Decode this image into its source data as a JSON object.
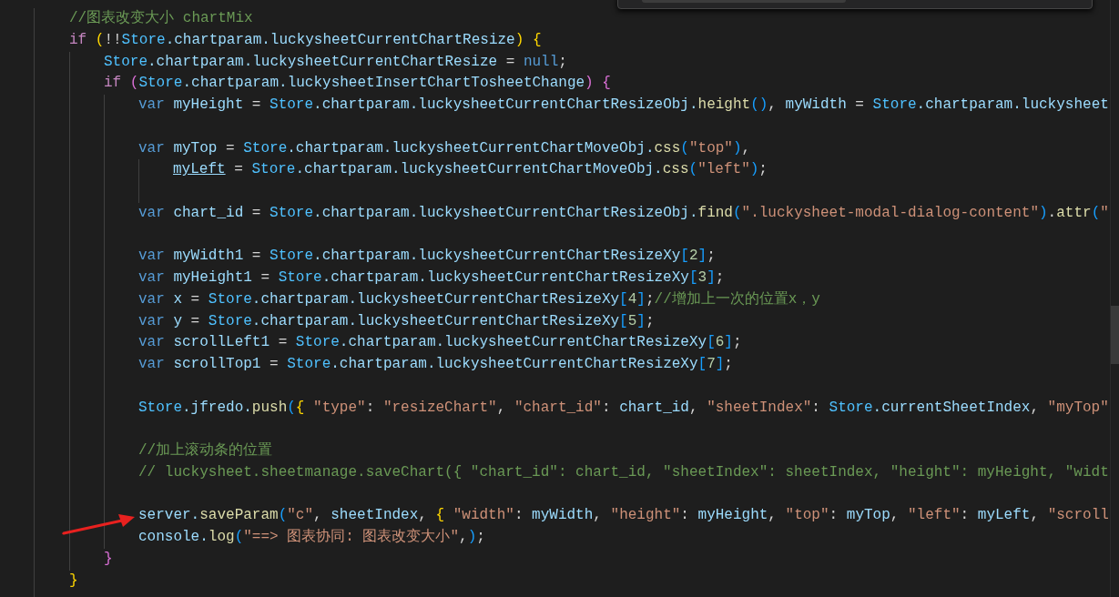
{
  "editor": {
    "lines": [
      {
        "kind": "code",
        "tokens": [
          {
            "kind": "cm",
            "text": "//图表改变大小 chartMix"
          }
        ]
      },
      {
        "kind": "code",
        "tokens": [
          {
            "kind": "kw",
            "text": "if"
          },
          {
            "kind": "b1",
            "text": " ("
          },
          {
            "kind": "p",
            "text": "!!"
          },
          {
            "kind": "obj",
            "text": "Store"
          },
          {
            "kind": "id",
            "text": ".chartparam.luckysheetCurrentChartResize"
          },
          {
            "kind": "b1",
            "text": ")"
          },
          {
            "kind": "b1",
            "text": " {"
          }
        ],
        "children": [
          {
            "kind": "code",
            "tokens": [
              {
                "kind": "obj",
                "text": "Store"
              },
              {
                "kind": "id",
                "text": ".chartparam.luckysheetCurrentChartResize"
              },
              {
                "kind": "p",
                "text": " = "
              },
              {
                "kind": "st",
                "text": "null"
              },
              {
                "kind": "p",
                "text": ";"
              }
            ]
          },
          {
            "kind": "code",
            "tokens": [
              {
                "kind": "kw",
                "text": "if"
              },
              {
                "kind": "b2",
                "text": " ("
              },
              {
                "kind": "obj",
                "text": "Store"
              },
              {
                "kind": "id",
                "text": ".chartparam.luckysheetInsertChartTosheetChange"
              },
              {
                "kind": "b2",
                "text": ")"
              },
              {
                "kind": "b2",
                "text": " {"
              }
            ],
            "children": [
              {
                "kind": "code",
                "tokens": [
                  {
                    "kind": "st",
                    "text": "var"
                  },
                  {
                    "kind": "id",
                    "text": " myHeight"
                  },
                  {
                    "kind": "p",
                    "text": " = "
                  },
                  {
                    "kind": "obj",
                    "text": "Store"
                  },
                  {
                    "kind": "id",
                    "text": ".chartparam.luckysheetCurrentChartResizeObj."
                  },
                  {
                    "kind": "fn",
                    "text": "height"
                  },
                  {
                    "kind": "b3",
                    "text": "()"
                  },
                  {
                    "kind": "p",
                    "text": ", "
                  },
                  {
                    "kind": "id",
                    "text": "myWidth"
                  },
                  {
                    "kind": "p",
                    "text": " = "
                  },
                  {
                    "kind": "obj",
                    "text": "Store"
                  },
                  {
                    "kind": "id",
                    "text": ".chartparam.luckysheet"
                  }
                ]
              },
              {
                "kind": "blank"
              },
              {
                "kind": "code",
                "tokens": [
                  {
                    "kind": "st",
                    "text": "var"
                  },
                  {
                    "kind": "id",
                    "text": " myTop"
                  },
                  {
                    "kind": "p",
                    "text": " = "
                  },
                  {
                    "kind": "obj",
                    "text": "Store"
                  },
                  {
                    "kind": "id",
                    "text": ".chartparam.luckysheetCurrentChartMoveObj."
                  },
                  {
                    "kind": "fn",
                    "text": "css"
                  },
                  {
                    "kind": "b3",
                    "text": "("
                  },
                  {
                    "kind": "str",
                    "text": "\"top\""
                  },
                  {
                    "kind": "b3",
                    "text": ")"
                  },
                  {
                    "kind": "p",
                    "text": ","
                  }
                ],
                "children": [
                  {
                    "kind": "code",
                    "tokens": [
                      {
                        "kind": "ul",
                        "text": "myLeft"
                      },
                      {
                        "kind": "p",
                        "text": " = "
                      },
                      {
                        "kind": "obj",
                        "text": "Store"
                      },
                      {
                        "kind": "id",
                        "text": ".chartparam.luckysheetCurrentChartMoveObj."
                      },
                      {
                        "kind": "fn",
                        "text": "css"
                      },
                      {
                        "kind": "b3",
                        "text": "("
                      },
                      {
                        "kind": "str",
                        "text": "\"left\""
                      },
                      {
                        "kind": "b3",
                        "text": ")"
                      },
                      {
                        "kind": "p",
                        "text": ";"
                      }
                    ]
                  },
                  {
                    "kind": "blank"
                  }
                ]
              },
              {
                "kind": "code",
                "tokens": [
                  {
                    "kind": "st",
                    "text": "var"
                  },
                  {
                    "kind": "id",
                    "text": " chart_id"
                  },
                  {
                    "kind": "p",
                    "text": " = "
                  },
                  {
                    "kind": "obj",
                    "text": "Store"
                  },
                  {
                    "kind": "id",
                    "text": ".chartparam.luckysheetCurrentChartResizeObj."
                  },
                  {
                    "kind": "fn",
                    "text": "find"
                  },
                  {
                    "kind": "b3",
                    "text": "("
                  },
                  {
                    "kind": "str",
                    "text": "\".luckysheet-modal-dialog-content\""
                  },
                  {
                    "kind": "b3",
                    "text": ")"
                  },
                  {
                    "kind": "p",
                    "text": "."
                  },
                  {
                    "kind": "fn",
                    "text": "attr"
                  },
                  {
                    "kind": "b3",
                    "text": "("
                  },
                  {
                    "kind": "str",
                    "text": "\""
                  }
                ]
              },
              {
                "kind": "blank"
              },
              {
                "kind": "code",
                "tokens": [
                  {
                    "kind": "st",
                    "text": "var"
                  },
                  {
                    "kind": "id",
                    "text": " myWidth1"
                  },
                  {
                    "kind": "p",
                    "text": " = "
                  },
                  {
                    "kind": "obj",
                    "text": "Store"
                  },
                  {
                    "kind": "id",
                    "text": ".chartparam.luckysheetCurrentChartResizeXy"
                  },
                  {
                    "kind": "b3",
                    "text": "["
                  },
                  {
                    "kind": "num",
                    "text": "2"
                  },
                  {
                    "kind": "b3",
                    "text": "]"
                  },
                  {
                    "kind": "p",
                    "text": ";"
                  }
                ]
              },
              {
                "kind": "code",
                "tokens": [
                  {
                    "kind": "st",
                    "text": "var"
                  },
                  {
                    "kind": "id",
                    "text": " myHeight1"
                  },
                  {
                    "kind": "p",
                    "text": " = "
                  },
                  {
                    "kind": "obj",
                    "text": "Store"
                  },
                  {
                    "kind": "id",
                    "text": ".chartparam.luckysheetCurrentChartResizeXy"
                  },
                  {
                    "kind": "b3",
                    "text": "["
                  },
                  {
                    "kind": "num",
                    "text": "3"
                  },
                  {
                    "kind": "b3",
                    "text": "]"
                  },
                  {
                    "kind": "p",
                    "text": ";"
                  }
                ]
              },
              {
                "kind": "code",
                "tokens": [
                  {
                    "kind": "st",
                    "text": "var"
                  },
                  {
                    "kind": "id",
                    "text": " x"
                  },
                  {
                    "kind": "p",
                    "text": " = "
                  },
                  {
                    "kind": "obj",
                    "text": "Store"
                  },
                  {
                    "kind": "id",
                    "text": ".chartparam.luckysheetCurrentChartResizeXy"
                  },
                  {
                    "kind": "b3",
                    "text": "["
                  },
                  {
                    "kind": "num",
                    "text": "4"
                  },
                  {
                    "kind": "b3",
                    "text": "]"
                  },
                  {
                    "kind": "p",
                    "text": ";"
                  },
                  {
                    "kind": "cm",
                    "text": "//增加上一次的位置x，y"
                  }
                ]
              },
              {
                "kind": "code",
                "tokens": [
                  {
                    "kind": "st",
                    "text": "var"
                  },
                  {
                    "kind": "id",
                    "text": " y"
                  },
                  {
                    "kind": "p",
                    "text": " = "
                  },
                  {
                    "kind": "obj",
                    "text": "Store"
                  },
                  {
                    "kind": "id",
                    "text": ".chartparam.luckysheetCurrentChartResizeXy"
                  },
                  {
                    "kind": "b3",
                    "text": "["
                  },
                  {
                    "kind": "num",
                    "text": "5"
                  },
                  {
                    "kind": "b3",
                    "text": "]"
                  },
                  {
                    "kind": "p",
                    "text": ";"
                  }
                ]
              },
              {
                "kind": "code",
                "tokens": [
                  {
                    "kind": "st",
                    "text": "var"
                  },
                  {
                    "kind": "id",
                    "text": " scrollLeft1"
                  },
                  {
                    "kind": "p",
                    "text": " = "
                  },
                  {
                    "kind": "obj",
                    "text": "Store"
                  },
                  {
                    "kind": "id",
                    "text": ".chartparam.luckysheetCurrentChartResizeXy"
                  },
                  {
                    "kind": "b3",
                    "text": "["
                  },
                  {
                    "kind": "num",
                    "text": "6"
                  },
                  {
                    "kind": "b3",
                    "text": "]"
                  },
                  {
                    "kind": "p",
                    "text": ";"
                  }
                ]
              },
              {
                "kind": "code",
                "tokens": [
                  {
                    "kind": "st",
                    "text": "var"
                  },
                  {
                    "kind": "id",
                    "text": " scrollTop1"
                  },
                  {
                    "kind": "p",
                    "text": " = "
                  },
                  {
                    "kind": "obj",
                    "text": "Store"
                  },
                  {
                    "kind": "id",
                    "text": ".chartparam.luckysheetCurrentChartResizeXy"
                  },
                  {
                    "kind": "b3",
                    "text": "["
                  },
                  {
                    "kind": "num",
                    "text": "7"
                  },
                  {
                    "kind": "b3",
                    "text": "]"
                  },
                  {
                    "kind": "p",
                    "text": ";"
                  }
                ]
              },
              {
                "kind": "blank"
              },
              {
                "kind": "code",
                "tokens": [
                  {
                    "kind": "obj",
                    "text": "Store"
                  },
                  {
                    "kind": "id",
                    "text": ".jfredo."
                  },
                  {
                    "kind": "fn",
                    "text": "push"
                  },
                  {
                    "kind": "b3",
                    "text": "("
                  },
                  {
                    "kind": "b1",
                    "text": "{"
                  },
                  {
                    "kind": "str",
                    "text": " \"type\""
                  },
                  {
                    "kind": "p",
                    "text": ": "
                  },
                  {
                    "kind": "str",
                    "text": "\"resizeChart\""
                  },
                  {
                    "kind": "p",
                    "text": ", "
                  },
                  {
                    "kind": "str",
                    "text": "\"chart_id\""
                  },
                  {
                    "kind": "p",
                    "text": ": "
                  },
                  {
                    "kind": "id",
                    "text": "chart_id"
                  },
                  {
                    "kind": "p",
                    "text": ", "
                  },
                  {
                    "kind": "str",
                    "text": "\"sheetIndex\""
                  },
                  {
                    "kind": "p",
                    "text": ": "
                  },
                  {
                    "kind": "obj",
                    "text": "Store"
                  },
                  {
                    "kind": "id",
                    "text": ".currentSheetIndex"
                  },
                  {
                    "kind": "p",
                    "text": ", "
                  },
                  {
                    "kind": "str",
                    "text": "\"myTop\""
                  }
                ]
              },
              {
                "kind": "blank"
              },
              {
                "kind": "code",
                "tokens": [
                  {
                    "kind": "cm",
                    "text": "//加上滚动条的位置"
                  }
                ]
              },
              {
                "kind": "code",
                "tokens": [
                  {
                    "kind": "cm",
                    "text": "// luckysheet.sheetmanage.saveChart({ \"chart_id\": chart_id, \"sheetIndex\": sheetIndex, \"height\": myHeight, \"widt"
                  }
                ]
              },
              {
                "kind": "blank"
              },
              {
                "kind": "code",
                "arrow": true,
                "tokens": [
                  {
                    "kind": "id",
                    "text": "server."
                  },
                  {
                    "kind": "fn",
                    "text": "saveParam"
                  },
                  {
                    "kind": "b3",
                    "text": "("
                  },
                  {
                    "kind": "str",
                    "text": "\"c\""
                  },
                  {
                    "kind": "p",
                    "text": ", "
                  },
                  {
                    "kind": "id",
                    "text": "sheetIndex"
                  },
                  {
                    "kind": "p",
                    "text": ", "
                  },
                  {
                    "kind": "b1",
                    "text": "{"
                  },
                  {
                    "kind": "str",
                    "text": " \"width\""
                  },
                  {
                    "kind": "p",
                    "text": ": "
                  },
                  {
                    "kind": "id",
                    "text": "myWidth"
                  },
                  {
                    "kind": "p",
                    "text": ", "
                  },
                  {
                    "kind": "str",
                    "text": "\"height\""
                  },
                  {
                    "kind": "p",
                    "text": ": "
                  },
                  {
                    "kind": "id",
                    "text": "myHeight"
                  },
                  {
                    "kind": "p",
                    "text": ", "
                  },
                  {
                    "kind": "str",
                    "text": "\"top\""
                  },
                  {
                    "kind": "p",
                    "text": ": "
                  },
                  {
                    "kind": "id",
                    "text": "myTop"
                  },
                  {
                    "kind": "p",
                    "text": ", "
                  },
                  {
                    "kind": "str",
                    "text": "\"left\""
                  },
                  {
                    "kind": "p",
                    "text": ": "
                  },
                  {
                    "kind": "id",
                    "text": "myLeft"
                  },
                  {
                    "kind": "p",
                    "text": ", "
                  },
                  {
                    "kind": "str",
                    "text": "\"scroll"
                  }
                ]
              },
              {
                "kind": "code",
                "tokens": [
                  {
                    "kind": "id",
                    "text": "console."
                  },
                  {
                    "kind": "fn",
                    "text": "log"
                  },
                  {
                    "kind": "b3",
                    "text": "("
                  },
                  {
                    "kind": "str",
                    "text": "\"==> 图表协同: 图表改变大小\""
                  },
                  {
                    "kind": "p",
                    "text": ","
                  },
                  {
                    "kind": "b3",
                    "text": ")"
                  },
                  {
                    "kind": "p",
                    "text": ";"
                  }
                ]
              }
            ]
          },
          {
            "kind": "code",
            "tokens": [
              {
                "kind": "b2",
                "text": "}"
              }
            ]
          }
        ]
      },
      {
        "kind": "code",
        "tokens": [
          {
            "kind": "b1",
            "text": "}"
          }
        ]
      }
    ]
  }
}
